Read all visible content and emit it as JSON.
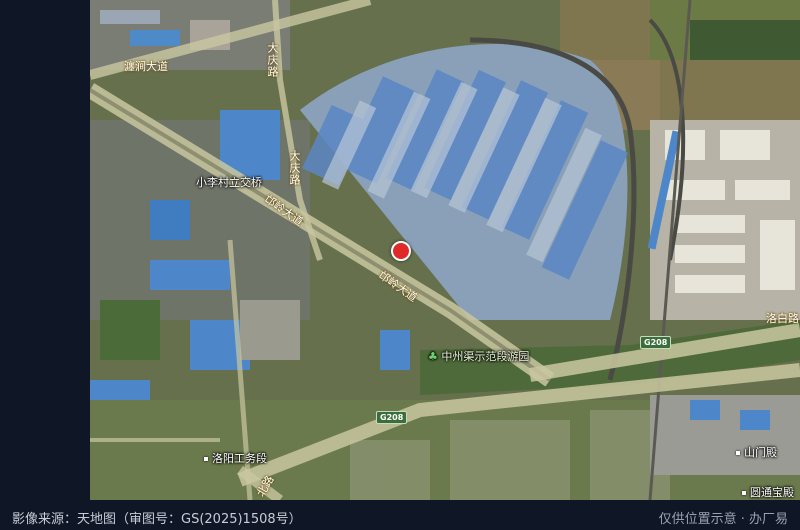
{
  "map": {
    "labels": {
      "xiaoli_bridge": "小李村立交桥",
      "chanjian_road": "瀍涧大道",
      "daqing_road_1": "大庆路",
      "daqing_road_2": "大庆路",
      "yinling_road_1": "邙岭大道",
      "yinling_road_2": "邙岭大道",
      "zhongzhou_park": "中州渠示范段游园",
      "luoyang_works": "洛阳工务段",
      "luobai_road": "洛白路",
      "shanmen": "山门殿",
      "yuantong": "圆通宝殿",
      "north_road": "北路"
    },
    "shields": {
      "g208_east": "G208",
      "g208_south": "G208"
    },
    "icons": {
      "marker": "location-pin-icon",
      "park": "tree-icon"
    },
    "colors": {
      "marker": "#e02a2a",
      "road_label": "#f0d27a"
    }
  },
  "footer": {
    "source": "影像来源：天地图（审图号：GS(2025)1508号）",
    "disclaimer": "仅供位置示意 · 办厂易"
  }
}
